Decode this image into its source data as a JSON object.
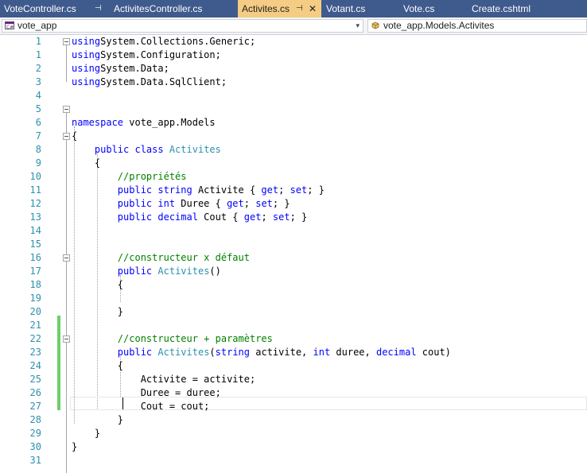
{
  "tabs": [
    {
      "label": "VoteController.cs",
      "pin": "⊣",
      "active": false
    },
    {
      "label": "ActivitesController.cs",
      "active": false
    },
    {
      "label": "Activites.cs",
      "pin": "⊣",
      "close": "✕",
      "active": true
    },
    {
      "label": "Votant.cs",
      "active": false
    },
    {
      "label": "Vote.cs",
      "active": false
    },
    {
      "label": "Create.cshtml",
      "active": false
    }
  ],
  "navbar": {
    "project": "vote_app",
    "member": "vote_app.Models.Activites",
    "dropdown_arrow": "▾"
  },
  "code_lines": [
    {
      "n": "1",
      "tokens": [
        [
          "kw",
          "using"
        ],
        [
          "",
          "System.Collections.Generic;"
        ]
      ]
    },
    {
      "n": "1",
      "tokens": [
        [
          "kw",
          "using"
        ],
        [
          "",
          "System.Configuration;"
        ]
      ]
    },
    {
      "n": "2",
      "tokens": [
        [
          "kw",
          "using"
        ],
        [
          "",
          "System.Data;"
        ]
      ]
    },
    {
      "n": "3",
      "tokens": [
        [
          "kw",
          "using"
        ],
        [
          "",
          "System.Data.SqlClient;"
        ]
      ]
    },
    {
      "n": "4",
      "tokens": []
    },
    {
      "n": "5",
      "tokens": []
    },
    {
      "n": "6",
      "tokens": [
        [
          "kw",
          "namespace"
        ],
        [
          "",
          " vote_app.Models"
        ]
      ]
    },
    {
      "n": "7",
      "tokens": [
        [
          "",
          "{"
        ]
      ]
    },
    {
      "n": "8",
      "tokens": [
        [
          "",
          "    "
        ],
        [
          "kw",
          "public class"
        ],
        [
          "",
          " "
        ],
        [
          "ty",
          "Activites"
        ]
      ]
    },
    {
      "n": "9",
      "tokens": [
        [
          "",
          "    {"
        ]
      ]
    },
    {
      "n": "10",
      "tokens": [
        [
          "",
          "        "
        ],
        [
          "cm",
          "//propriétés"
        ]
      ]
    },
    {
      "n": "11",
      "tokens": [
        [
          "",
          "        "
        ],
        [
          "kw",
          "public string"
        ],
        [
          "",
          " Activite { "
        ],
        [
          "kw",
          "get"
        ],
        [
          "",
          "; "
        ],
        [
          "kw",
          "set"
        ],
        [
          "",
          "; }"
        ]
      ]
    },
    {
      "n": "12",
      "tokens": [
        [
          "",
          "        "
        ],
        [
          "kw",
          "public int"
        ],
        [
          "",
          " Duree { "
        ],
        [
          "kw",
          "get"
        ],
        [
          "",
          "; "
        ],
        [
          "kw",
          "set"
        ],
        [
          "",
          "; }"
        ]
      ]
    },
    {
      "n": "13",
      "tokens": [
        [
          "",
          "        "
        ],
        [
          "kw",
          "public decimal"
        ],
        [
          "",
          " Cout { "
        ],
        [
          "kw",
          "get"
        ],
        [
          "",
          "; "
        ],
        [
          "kw",
          "set"
        ],
        [
          "",
          "; }"
        ]
      ]
    },
    {
      "n": "14",
      "tokens": []
    },
    {
      "n": "15",
      "tokens": []
    },
    {
      "n": "16",
      "tokens": [
        [
          "",
          "        "
        ],
        [
          "cm",
          "//constructeur x défaut"
        ]
      ]
    },
    {
      "n": "17",
      "tokens": [
        [
          "",
          "        "
        ],
        [
          "kw",
          "public"
        ],
        [
          "",
          " "
        ],
        [
          "ty",
          "Activites"
        ],
        [
          "",
          "()"
        ]
      ]
    },
    {
      "n": "18",
      "tokens": [
        [
          "",
          "        {"
        ]
      ]
    },
    {
      "n": "19",
      "tokens": []
    },
    {
      "n": "20",
      "tokens": [
        [
          "",
          "        }"
        ]
      ]
    },
    {
      "n": "21",
      "tokens": []
    },
    {
      "n": "22",
      "tokens": [
        [
          "",
          "        "
        ],
        [
          "cm",
          "//constructeur + paramètres"
        ]
      ]
    },
    {
      "n": "23",
      "tokens": [
        [
          "",
          "        "
        ],
        [
          "kw",
          "public"
        ],
        [
          "",
          " "
        ],
        [
          "ty",
          "Activites"
        ],
        [
          "",
          "("
        ],
        [
          "kw",
          "string"
        ],
        [
          "",
          " activite, "
        ],
        [
          "kw",
          "int"
        ],
        [
          "",
          " duree, "
        ],
        [
          "kw",
          "decimal"
        ],
        [
          "",
          " cout)"
        ]
      ]
    },
    {
      "n": "24",
      "tokens": [
        [
          "",
          "        {"
        ]
      ]
    },
    {
      "n": "25",
      "tokens": [
        [
          "",
          "            Activite = activite;"
        ]
      ]
    },
    {
      "n": "26",
      "tokens": [
        [
          "",
          "            Duree = duree;"
        ]
      ]
    },
    {
      "n": "27",
      "tokens": [
        [
          "",
          "            Cout = cout;"
        ]
      ]
    },
    {
      "n": "28",
      "tokens": [
        [
          "",
          "        }"
        ]
      ]
    },
    {
      "n": "29",
      "tokens": [
        [
          "",
          "    }"
        ]
      ]
    },
    {
      "n": "30",
      "tokens": [
        [
          "",
          "}"
        ]
      ]
    },
    {
      "n": "31",
      "tokens": []
    }
  ],
  "colors": {
    "keyword": "#0000ff",
    "type": "#2b91af",
    "comment": "#008000",
    "line_number": "#2b91af",
    "tab_bar": "#3f5a8c",
    "active_tab": "#f5cc84",
    "change_marker": "#6ccf6c"
  }
}
